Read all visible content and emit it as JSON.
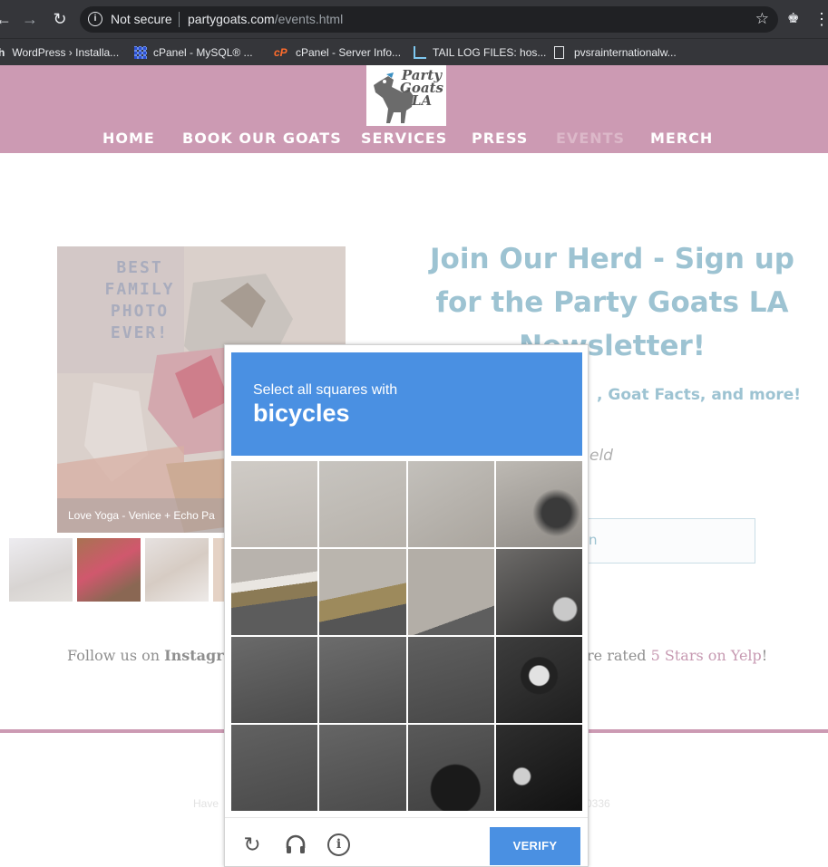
{
  "browser": {
    "security_label": "Not secure",
    "url_domain": "partygoats.com",
    "url_path": "/events.html",
    "bookmarks": [
      {
        "label": "WordPress › Installa...",
        "icon": "wordpress-icon"
      },
      {
        "label": "cPanel - MySQL® ...",
        "icon": "grid-icon"
      },
      {
        "label": "cPanel - Server Info...",
        "icon": "cpanel-icon"
      },
      {
        "label": "TAIL LOG FILES: hos...",
        "icon": "chart-icon"
      },
      {
        "label": "pvsrainternationalw...",
        "icon": "page-icon"
      }
    ]
  },
  "site": {
    "logo_text": "Party Goats LA",
    "nav": [
      {
        "label": "HOME"
      },
      {
        "label": "BOOK OUR GOATS"
      },
      {
        "label": "SERVICES"
      },
      {
        "label": "PRESS"
      },
      {
        "label": "EVENTS"
      },
      {
        "label": "MERCH"
      }
    ],
    "gallery": {
      "image_text": "BEST FAMILY PHOTO EVER!",
      "caption": "Love Yoga - Venice + Echo Pa"
    },
    "newsletter": {
      "title": "Join Our Herd - Sign up for the Party Goats LA Newsletter!",
      "subtitle_visible": ", Goat Facts, and more!",
      "required_visible": "eld",
      "input_placeholder_visible": "n"
    },
    "follow": {
      "prefix": "Follow us on ",
      "instagram": "Instagram",
      "rated_visible": "re rated ",
      "yelp": "5 Stars on Yelp",
      "yelp_suffix": "!"
    },
    "footer": {
      "left_visible": "Have",
      "right_visible": "0336"
    }
  },
  "captcha": {
    "prompt": "Select all squares with",
    "target": "bicycles",
    "verify_label": "VERIFY",
    "color": "#4a90e2"
  }
}
